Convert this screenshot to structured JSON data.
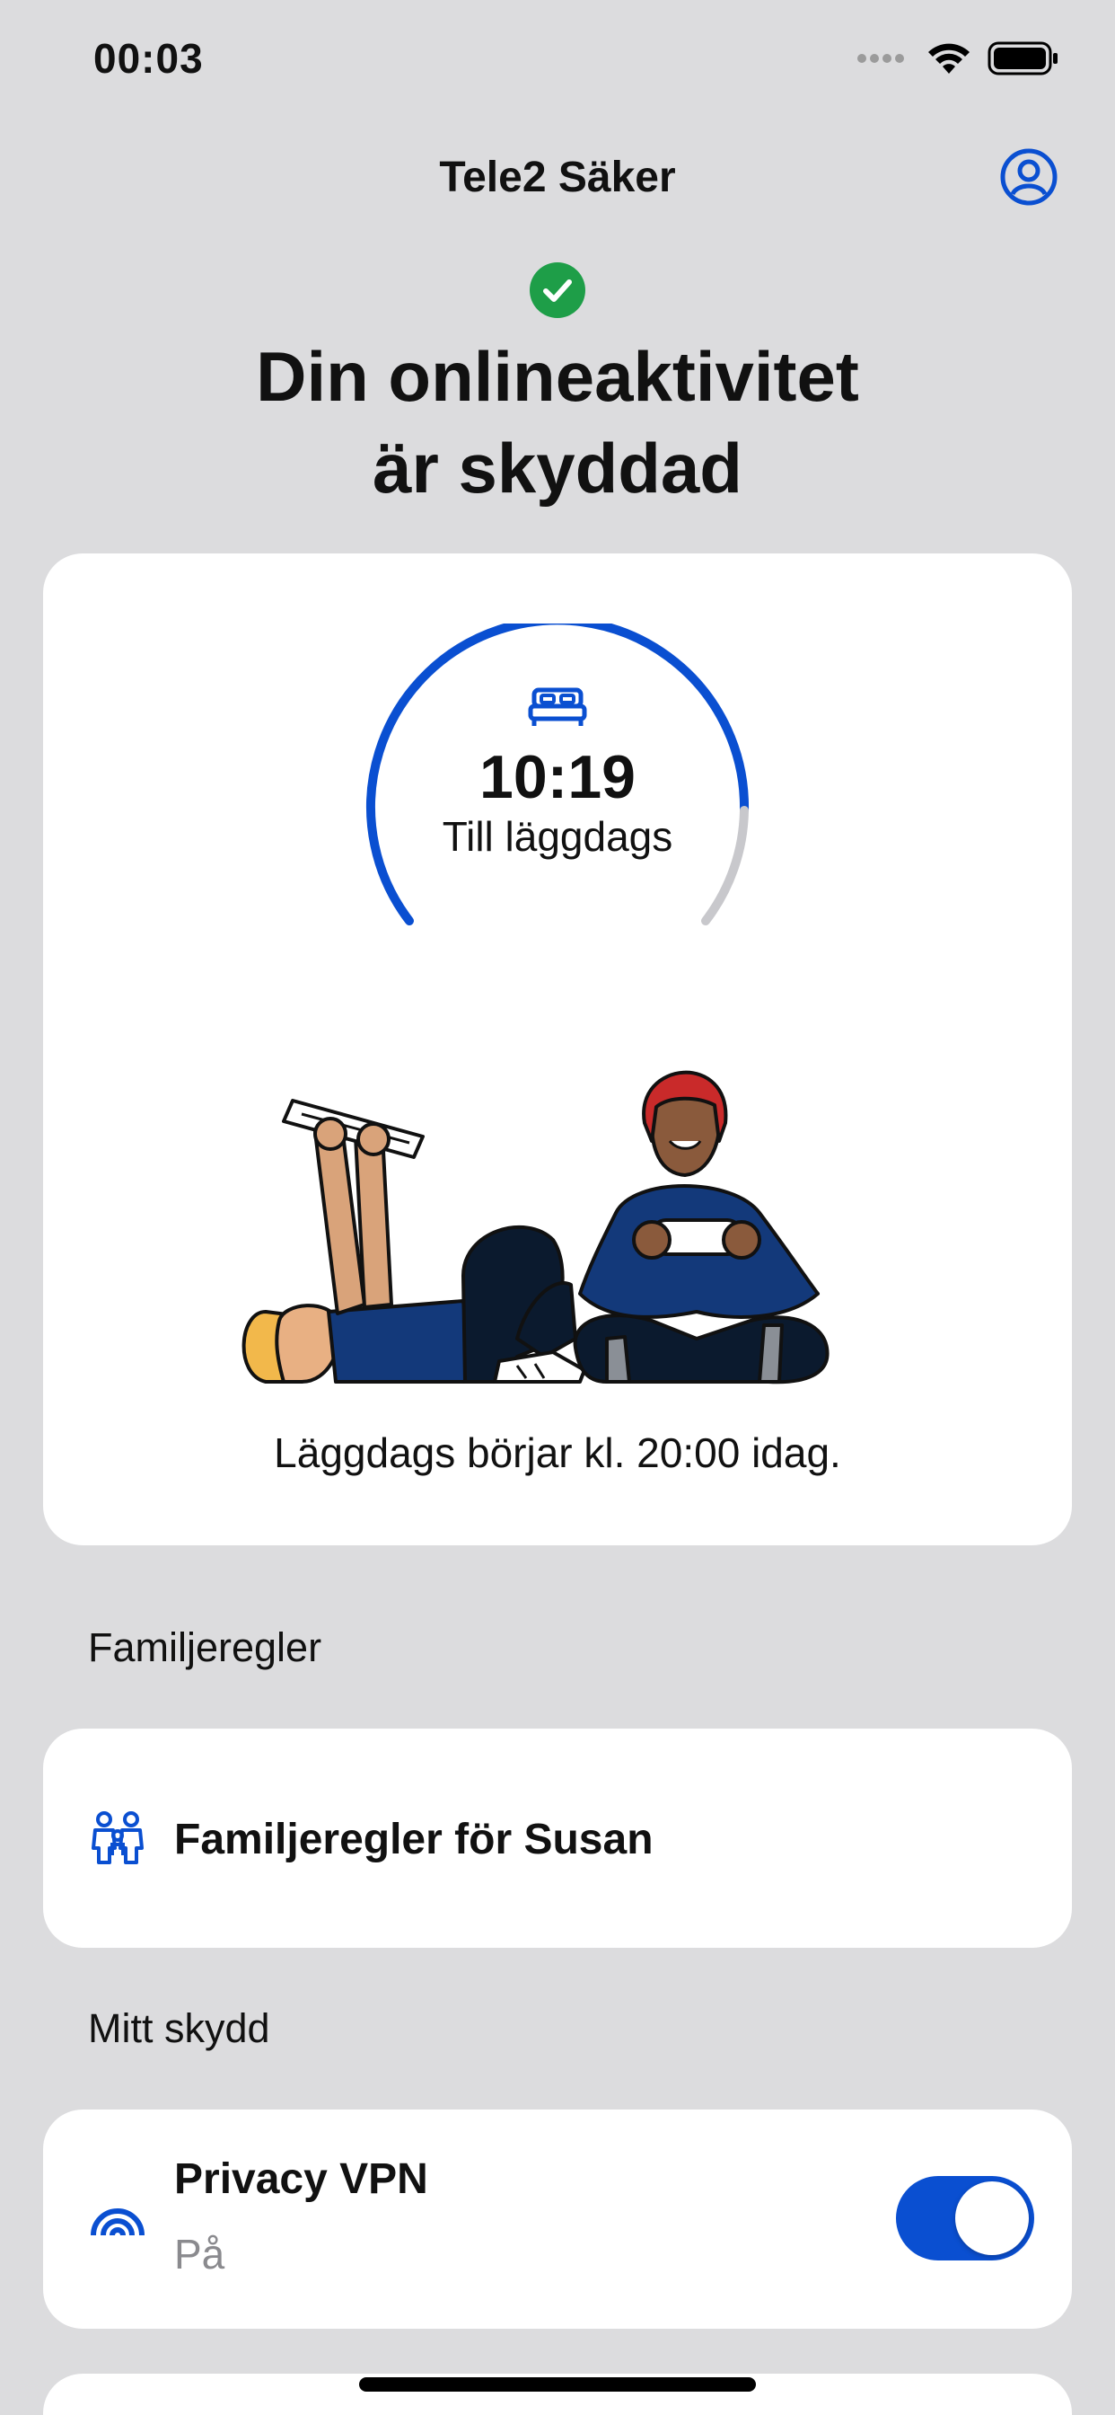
{
  "status_bar": {
    "time": "00:03"
  },
  "nav": {
    "title": "Tele2 Säker"
  },
  "header": {
    "line1": "Din onlineaktivitet",
    "line2": "är skyddad"
  },
  "bedtime": {
    "time_remaining": "10:19",
    "label": "Till läggdags",
    "note": "Läggdags börjar kl. 20:00 idag."
  },
  "sections": {
    "family_rules": "Familjeregler",
    "my_protection": "Mitt skydd"
  },
  "family_rules_item": {
    "label": "Familjeregler för Susan"
  },
  "vpn": {
    "title": "Privacy VPN",
    "status": "På",
    "enabled": true
  },
  "colors": {
    "accent": "#0a4fd1",
    "success": "#1e9e48",
    "background": "#dcdcde",
    "card": "#ffffff",
    "muted_text": "#8a8a8e"
  },
  "icons": [
    "wifi-icon",
    "battery-icon",
    "profile-icon",
    "check-icon",
    "bed-icon",
    "family-icon",
    "vpn-signal-icon"
  ]
}
